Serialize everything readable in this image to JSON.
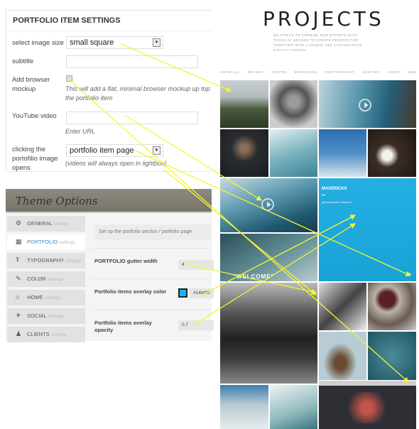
{
  "meta_box": {
    "title": "PORTFOLIO ITEM SETTINGS",
    "image_size_label": "select image size",
    "image_size_value": "small square",
    "subtitle_label": "subtitle",
    "subtitle_value": "",
    "browser_label": "Add browser mockup",
    "browser_checked": false,
    "browser_hint": "This will add a flat, minimal browser mockup up top the portfolio item",
    "youtube_label": "YouTube video",
    "youtube_value": "",
    "youtube_hint": "Enter URL",
    "click_label": "clicking the portofilio image opens",
    "click_value": "portfolio item page",
    "click_hint": "(videos will always open in lightbox)"
  },
  "theme_options": {
    "title": "Theme Options",
    "nav": [
      {
        "label": "GENERAL",
        "sub": "settings",
        "icon": "gear-icon",
        "active": false
      },
      {
        "label": "PORTFOLIO",
        "sub": "settings",
        "icon": "grid-icon",
        "active": true
      },
      {
        "label": "TYPOGRAPHY",
        "sub": "settings",
        "icon": "typography-icon",
        "active": false
      },
      {
        "label": "COLOR",
        "sub": "settings",
        "icon": "brush-icon",
        "active": false
      },
      {
        "label": "HOME",
        "sub": "settings",
        "icon": "home-icon",
        "active": false
      },
      {
        "label": "SOCIAL",
        "sub": "settings",
        "icon": "bird-icon",
        "active": false
      },
      {
        "label": "CLIENTS",
        "sub": "settings",
        "icon": "people-icon",
        "active": false
      }
    ],
    "section_desc": "Set up the portfolio section / portfolio page",
    "gutter_label": "PORTFOLIO gutter width",
    "gutter_value": "4",
    "color_label": "Portfolio items overlay color",
    "color_value": "#14b8f5",
    "opacity_label": "Portfolio items overlay opacity",
    "opacity_value": "0.7"
  },
  "projects": {
    "title": "PROJECTS",
    "description": "WE STRIVE TO COMBINE OUR EFFORTS WITH THOSE OF BRANDS TO CREATE PERSPECTIVE TOGETHER WITH A UNIQUE AND CUTTING-EDGE DIGITAL FASHION.",
    "filters": [
      "SHOW ALL",
      "BRANDS",
      "COFFEE",
      "MOUNTAINS",
      "PHOTOGRAPHY",
      "SURFING",
      "VIDEO",
      "WEB"
    ],
    "featured_title": "MAVERICKS",
    "featured_subtitle": "global website relaunch",
    "welcome_text": "\"WELCOME\"",
    "overlay_color": "#14b8f5",
    "arrow_color": "#f5f532"
  }
}
